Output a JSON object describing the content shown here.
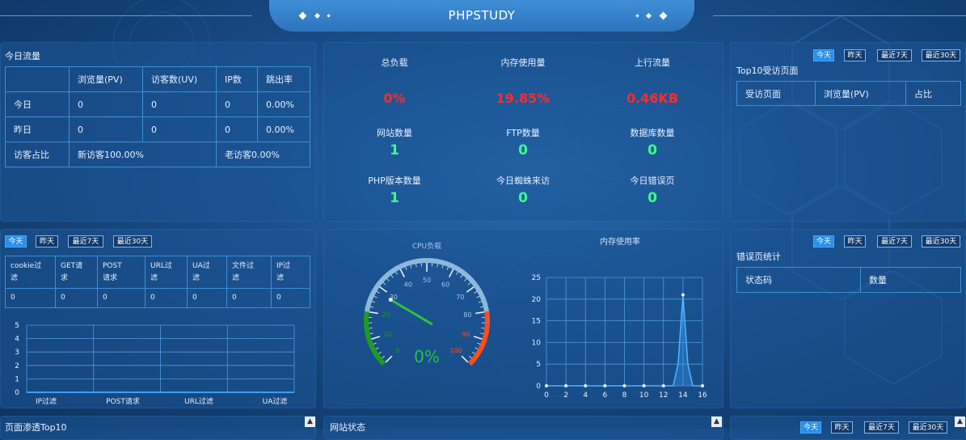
{
  "app": {
    "title": "PHPSTUDY"
  },
  "colors": {
    "accent": "#2a8fe6",
    "alert": "#ff2b2b",
    "ok": "#3dff8a",
    "gauge_needle": "#2fbf3f"
  },
  "traffic": {
    "title": "今日流量",
    "headers": [
      "",
      "浏览量(PV)",
      "访客数(UV)",
      "IP数",
      "跳出率"
    ],
    "rows": [
      [
        "今日",
        "0",
        "0",
        "0",
        "0.00%"
      ],
      [
        "昨日",
        "0",
        "0",
        "0",
        "0.00%"
      ]
    ],
    "ratio_label": "访客占比",
    "new_visitors": "新访客100.00%",
    "old_visitors": "老访客0.00%"
  },
  "stats": {
    "load_label": "总负载",
    "load_value": "0%",
    "mem_label": "内存使用量",
    "mem_value": "19.85%",
    "up_label": "上行流量",
    "up_value": "0.46KB",
    "site_label": "网站数量",
    "site_value": "1",
    "ftp_label": "FTP数量",
    "ftp_value": "0",
    "db_label": "数据库数量",
    "db_value": "0",
    "php_label": "PHP版本数量",
    "php_value": "1",
    "spider_label": "今日蜘蛛来访",
    "spider_value": "0",
    "error_label": "今日错误页",
    "error_value": "0"
  },
  "filters": {
    "today": "今天",
    "yesterday": "昨天",
    "last7": "最近7天",
    "last30": "最近30天"
  },
  "top10": {
    "title": "Top10受访页面",
    "headers": [
      "受访页面",
      "浏览量(PV)",
      "占比"
    ]
  },
  "errors": {
    "title": "错误页统计",
    "headers": [
      "状态码",
      "数量"
    ]
  },
  "waf": {
    "headers": [
      "cookie过滤",
      "GET请求",
      "POST请求",
      "URL过滤",
      "UA过滤",
      "文件过滤",
      "IP过滤"
    ],
    "values": [
      "0",
      "0",
      "0",
      "0",
      "0",
      "0",
      "0"
    ]
  },
  "cpu_gauge": {
    "title": "CPU负载",
    "value_label": "0%",
    "value": 0,
    "ticks": [
      "0",
      "10",
      "20",
      "30",
      "40",
      "50",
      "60",
      "70",
      "80",
      "90",
      "100"
    ]
  },
  "chart_data": [
    {
      "type": "line",
      "title": "",
      "x_tick_labels": [
        "IP过滤",
        "POST请求",
        "URL过滤",
        "UA过滤"
      ],
      "ylim": [
        0,
        5
      ],
      "y_ticks": [
        0,
        1,
        2,
        3,
        4,
        5
      ],
      "series": [
        {
          "values": [
            0,
            0,
            0,
            0,
            0,
            0,
            0
          ]
        }
      ]
    },
    {
      "type": "line",
      "title": "内存使用率",
      "x": [
        0,
        1,
        2,
        3,
        4,
        5,
        6,
        7,
        8,
        9,
        10,
        11,
        12,
        13,
        13.5,
        14,
        14.5,
        15,
        16
      ],
      "values": [
        0,
        0,
        0,
        0,
        0,
        0,
        0,
        0,
        0,
        0,
        0,
        0,
        0,
        0,
        5,
        21,
        5,
        0,
        0
      ],
      "xlim": [
        0,
        16
      ],
      "ylim": [
        0,
        25
      ],
      "x_ticks": [
        0,
        2,
        4,
        6,
        8,
        10,
        12,
        14,
        16
      ],
      "y_ticks": [
        0,
        5,
        10,
        15,
        20,
        25
      ]
    }
  ],
  "bottom": {
    "left_title": "页面渗透Top10",
    "mid_title": "网站状态",
    "right_buttons": [
      "今天",
      "昨天",
      "最近7天",
      "最近30天"
    ]
  }
}
